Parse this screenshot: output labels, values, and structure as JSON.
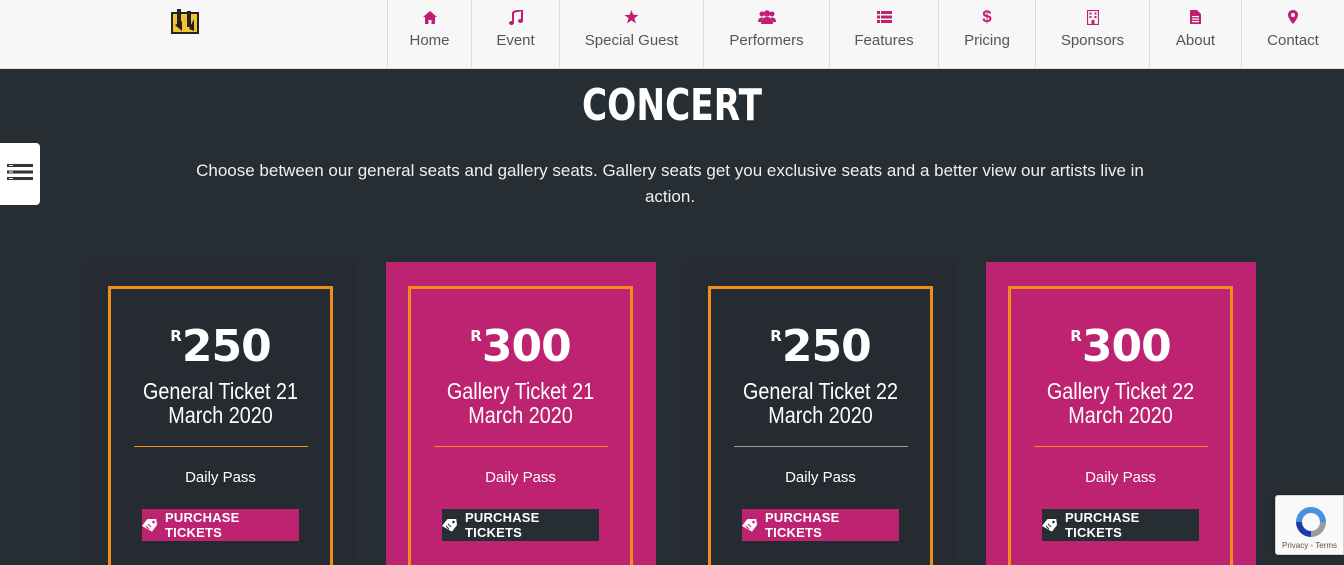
{
  "nav": [
    {
      "label": "Home",
      "icon": "home-icon"
    },
    {
      "label": "Event",
      "icon": "music-note-icon"
    },
    {
      "label": "Special Guest",
      "icon": "star-icon"
    },
    {
      "label": "Performers",
      "icon": "users-icon"
    },
    {
      "label": "Features",
      "icon": "list-icon"
    },
    {
      "label": "Pricing",
      "icon": "dollar-icon"
    },
    {
      "label": "Sponsors",
      "icon": "building-icon"
    },
    {
      "label": "About",
      "icon": "document-icon"
    },
    {
      "label": "Contact",
      "icon": "map-marker-icon"
    }
  ],
  "section": {
    "title": "CONCERT",
    "description": "Choose between our general seats and gallery seats. Gallery seats get you exclusive seats and a better view our artists live in action."
  },
  "cards": [
    {
      "currency": "R",
      "price": "250",
      "name_line1": "General Ticket 21",
      "name_line2": "March 2020",
      "pass": "Daily Pass",
      "button": "PURCHASE TICKETS"
    },
    {
      "currency": "R",
      "price": "300",
      "name_line1": "Gallery Ticket 21",
      "name_line2": "March 2020",
      "pass": "Daily Pass",
      "button": "PURCHASE TICKETS"
    },
    {
      "currency": "R",
      "price": "250",
      "name_line1": "General Ticket 22",
      "name_line2": "March 2020",
      "pass": "Daily Pass",
      "button": "PURCHASE TICKETS"
    },
    {
      "currency": "R",
      "price": "300",
      "name_line1": "Gallery Ticket 22",
      "name_line2": "March 2020",
      "pass": "Daily Pass",
      "button": "PURCHASE TICKETS"
    }
  ],
  "recaptcha": {
    "text": "Privacy - Terms"
  },
  "colors": {
    "accent": "#bd2370",
    "border": "#f08d1b",
    "background": "#262d33"
  }
}
